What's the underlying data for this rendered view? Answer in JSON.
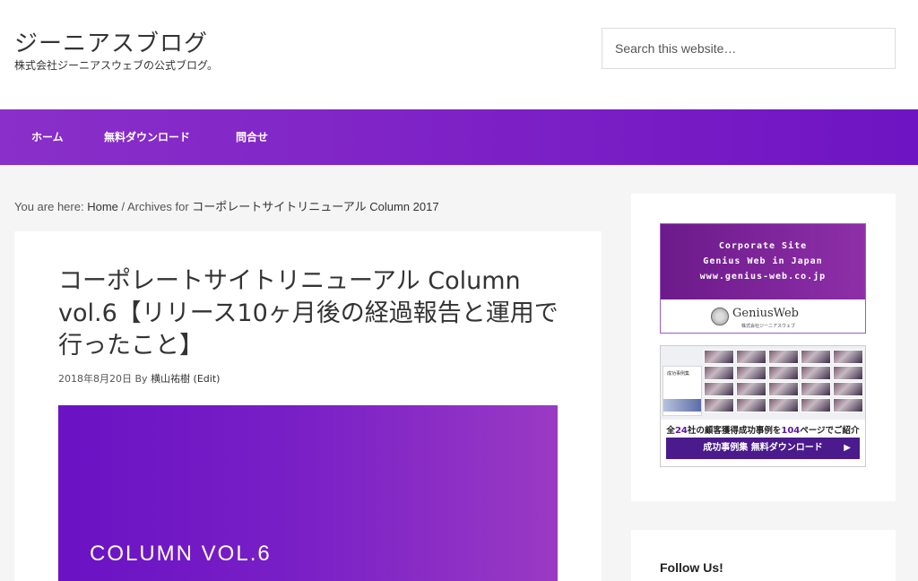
{
  "header": {
    "site_title": "ジーニアスブログ",
    "site_description": "株式会社ジーニアスウェブの公式ブログ。",
    "search_placeholder": "Search this website…"
  },
  "nav": {
    "items": [
      {
        "label": "ホーム"
      },
      {
        "label": "無料ダウンロード"
      },
      {
        "label": "問合せ"
      }
    ]
  },
  "breadcrumb": {
    "prefix": "You are here: ",
    "home": "Home",
    "separator": " / ",
    "archives_prefix": "Archives for ",
    "current": "コーポレートサイトリニューアル Column 2017"
  },
  "article": {
    "title": "コーポレートサイトリニューアル Column vol.6【リリース10ヶ月後の経過報告と運用で行ったこと】",
    "date": "2018年8月20日",
    "by": " By ",
    "author": "横山祐樹",
    "edit": " (Edit)",
    "featured_text": "COLUMN VOL.6"
  },
  "sidebar": {
    "banner1": {
      "line1": "Corporate Site",
      "line2": "Genius Web in Japan",
      "line3": "www.genius-web.co.jp",
      "logo_text": "GeniusWeb",
      "logo_sub": "株式会社ジーニアスウェブ"
    },
    "banner2": {
      "cover_label": "成功事例集",
      "caption_a": "全",
      "caption_num1": "24",
      "caption_b": "社の顧客獲得成功事例を",
      "caption_num2": "104",
      "caption_c": "ページでご紹介",
      "button_label": "成功事例集 無料ダウンロード",
      "button_arrow": "▶"
    },
    "follow_title": "Follow Us!"
  },
  "colors": {
    "nav_purple": "#7b1fc6",
    "featured_purple": "#7a20c6",
    "banner_button": "#4b1a8c"
  }
}
